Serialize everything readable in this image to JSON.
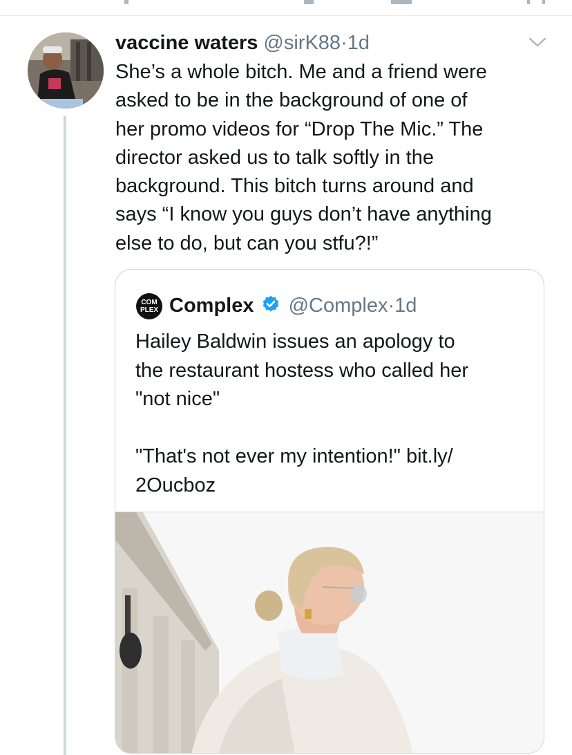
{
  "tweet": {
    "display_name": "vaccine waters",
    "handle": "@sirK88",
    "separator": "·",
    "time": "1d",
    "text_lines": [
      "She’s a whole bitch. Me and a friend were",
      "asked to be in the background of one of",
      "her promo videos for “Drop The Mic.” The",
      "director asked us to talk softly in the",
      "background. This bitch turns around and",
      "says “I know you guys don’t have anything",
      "else to do, but can you stfu?!”"
    ]
  },
  "quoted_tweet": {
    "logo_text_top": "COM",
    "logo_text_bottom": "PLEX",
    "display_name": "Complex",
    "handle": "@Complex",
    "separator": "·",
    "time": "1d",
    "text_lines": [
      "Hailey Baldwin issues an apology to",
      "the restaurant hostess who called her",
      "\"not nice\"",
      "",
      " \"That's not ever my intention!\" bit.ly/",
      "2Oucboz"
    ],
    "image_description_icon": "photo-woman-white-coat"
  },
  "colors": {
    "text_primary": "#14171a",
    "text_secondary": "#657786",
    "border": "#ccd6dd",
    "verified_blue": "#1da1f2"
  }
}
